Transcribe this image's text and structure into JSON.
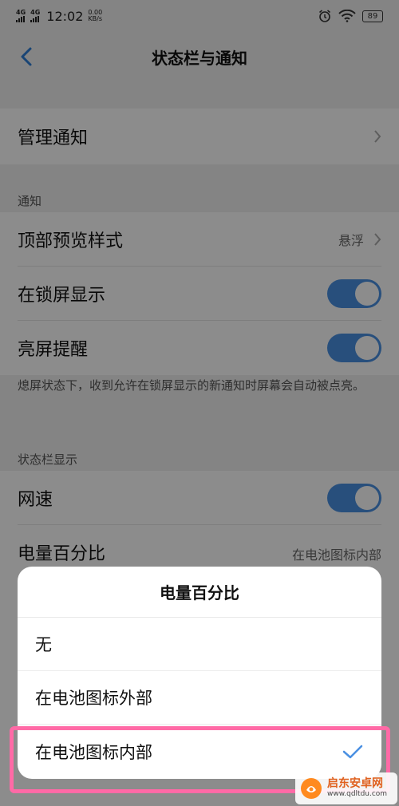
{
  "status_bar": {
    "sim1_tag": "4G",
    "sim2_tag": "4G",
    "time": "12:02",
    "net_speed_value": "0.00",
    "net_speed_unit": "KB/s",
    "battery": "89"
  },
  "header": {
    "title": "状态栏与通知"
  },
  "rows": {
    "manage_notifications": "管理通知",
    "section_notifications": "通知",
    "top_preview_label": "顶部预览样式",
    "top_preview_value": "悬浮",
    "lockscreen_label": "在锁屏显示",
    "screen_wake_label": "亮屏提醒",
    "screen_wake_desc": "熄屏状态下，收到允许在锁屏显示的新通知时屏幕会自动被点亮。",
    "section_statusbar": "状态栏显示",
    "net_speed_label": "网速",
    "battery_pct_label": "电量百分比",
    "battery_pct_value": "在电池图标内部"
  },
  "toggles": {
    "lockscreen_on": true,
    "screen_wake_on": true,
    "net_speed_on": true
  },
  "dialog": {
    "title": "电量百分比",
    "options": [
      "无",
      "在电池图标外部",
      "在电池图标内部"
    ],
    "selected_index": 2
  },
  "watermark": {
    "name": "启东安卓网",
    "url": "www.qdltdu.com"
  },
  "colors": {
    "accent": "#4a90e2",
    "highlight": "#ff6aa6"
  }
}
